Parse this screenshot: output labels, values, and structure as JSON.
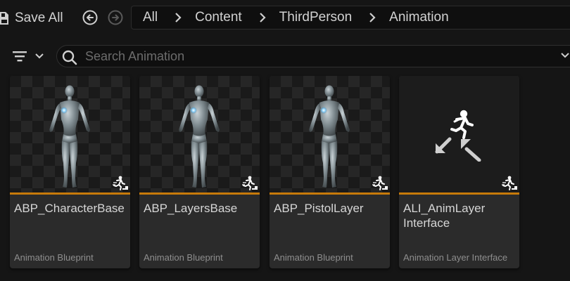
{
  "toolbar": {
    "save_all_label": "Save All"
  },
  "breadcrumbs": [
    "All",
    "Content",
    "ThirdPerson",
    "Animation"
  ],
  "search": {
    "placeholder": "Search Animation",
    "value": ""
  },
  "colors": {
    "accent": "#c77a0a",
    "background": "#151515",
    "tile": "#2b2b2b"
  },
  "assets": [
    {
      "name": "ABP_CharacterBase",
      "type": "Animation Blueprint",
      "thumbnail": "mannequin-preview"
    },
    {
      "name": "ABP_LayersBase",
      "type": "Animation Blueprint",
      "thumbnail": "mannequin-preview"
    },
    {
      "name": "ABP_PistolLayer",
      "type": "Animation Blueprint",
      "thumbnail": "mannequin-preview"
    },
    {
      "name": "ALI_AnimLayer Interface",
      "type": "Animation Layer Interface",
      "thumbnail": "anim-layer-interface-icon"
    }
  ],
  "icons": {
    "save": "save-icon",
    "back": "back-arrow-icon",
    "forward": "forward-arrow-icon",
    "filter": "filter-icon",
    "search": "search-icon",
    "asset_badge": "running-man-icon"
  }
}
